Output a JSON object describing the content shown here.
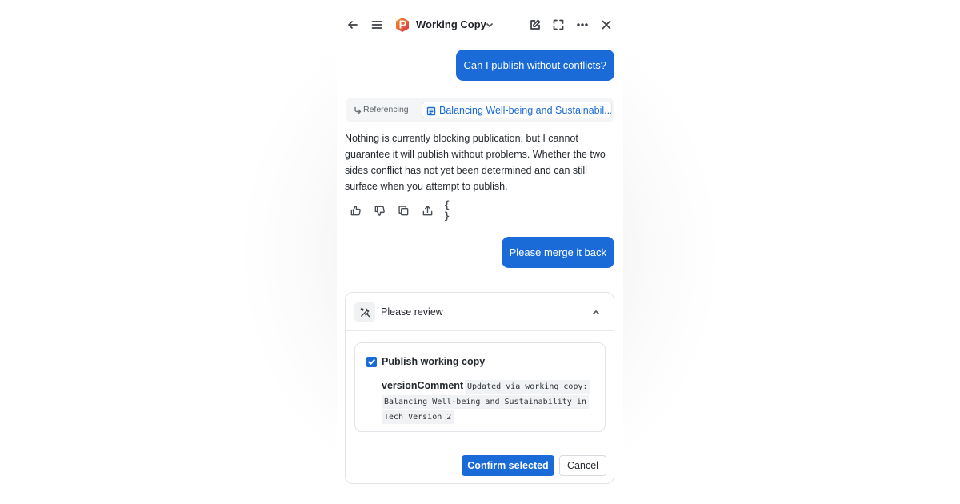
{
  "header": {
    "title": "Working Copy",
    "icons": [
      "back-arrow-icon",
      "menu-icon",
      "app-logo",
      "chevron-down-icon",
      "edit-icon",
      "expand-icon",
      "more-icon",
      "close-icon"
    ]
  },
  "conversation": {
    "user_message_1": "Can I publish without conflicts?",
    "referencing_label": "Referencing",
    "referenced_doc": "Balancing Well-being and Sustainabil...",
    "assistant_answer": "Nothing is currently blocking publication, but I cannot guarantee it will publish without problems. Whether the two sides conflict has not yet been determined and can still surface when you attempt to publish.",
    "answer_actions": [
      "thumbs-up-icon",
      "thumbs-down-icon",
      "copy-icon",
      "share-icon",
      "json-icon"
    ],
    "json_glyph": "{ }",
    "user_message_2": "Please merge it back"
  },
  "review": {
    "title": "Please review",
    "item_label": "Publish working copy",
    "item_checked": true,
    "param_key": "versionComment",
    "param_colon": ":",
    "param_value_lines": [
      "Updated via working copy:",
      "Balancing Well-being and Sustainability in",
      "Tech Version 2"
    ],
    "confirm_label": "Confirm selected",
    "cancel_label": "Cancel"
  },
  "colors": {
    "accent": "#1a6bd8",
    "logo_orange": "#f2672a",
    "logo_red": "#d8324a"
  }
}
